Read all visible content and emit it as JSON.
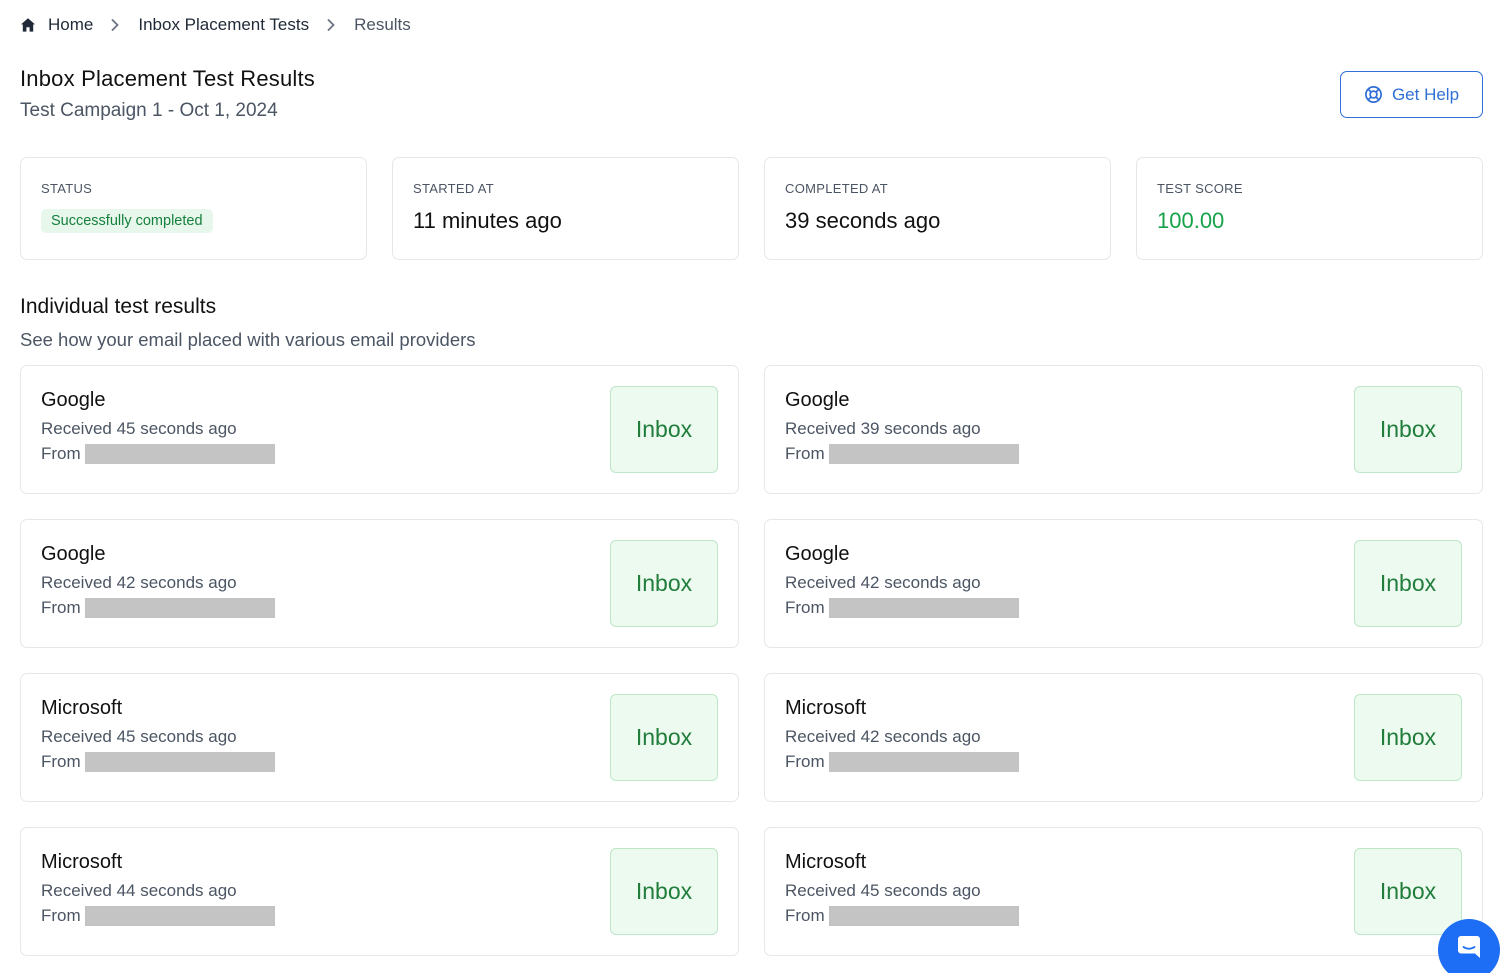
{
  "breadcrumb": {
    "home": "Home",
    "tests": "Inbox Placement Tests",
    "current": "Results"
  },
  "header": {
    "title": "Inbox Placement Test Results",
    "subtitle": "Test Campaign 1 - Oct 1, 2024",
    "help_label": "Get Help"
  },
  "stats": {
    "status": {
      "label": "STATUS",
      "value": "Successfully completed"
    },
    "started": {
      "label": "STARTED AT",
      "value": "11 minutes ago"
    },
    "completed": {
      "label": "COMPLETED AT",
      "value": "39 seconds ago"
    },
    "score": {
      "label": "TEST SCORE",
      "value": "100.00"
    }
  },
  "results_section": {
    "title": "Individual test results",
    "subtitle": "See how your email placed with various email providers",
    "from_label": "From",
    "items": [
      {
        "provider": "Google",
        "received": "Received 45 seconds ago",
        "placement": "Inbox"
      },
      {
        "provider": "Google",
        "received": "Received 39 seconds ago",
        "placement": "Inbox"
      },
      {
        "provider": "Google",
        "received": "Received 42 seconds ago",
        "placement": "Inbox"
      },
      {
        "provider": "Google",
        "received": "Received 42 seconds ago",
        "placement": "Inbox"
      },
      {
        "provider": "Microsoft",
        "received": "Received 45 seconds ago",
        "placement": "Inbox"
      },
      {
        "provider": "Microsoft",
        "received": "Received 42 seconds ago",
        "placement": "Inbox"
      },
      {
        "provider": "Microsoft",
        "received": "Received 44 seconds ago",
        "placement": "Inbox"
      },
      {
        "provider": "Microsoft",
        "received": "Received 45 seconds ago",
        "placement": "Inbox"
      }
    ]
  },
  "colors": {
    "accent": "#2f6fd6",
    "success": "#16a34a",
    "inbox_badge_bg": "#ecfaef",
    "chat_button": "#1d6ef5"
  },
  "icons": {
    "home": "home-icon",
    "separator": "chevron-right-icon",
    "help": "lifebuoy-icon",
    "chat": "chat-icon"
  }
}
